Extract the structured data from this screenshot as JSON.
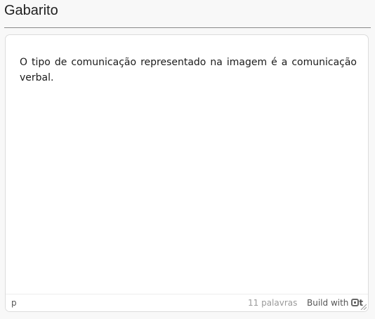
{
  "header": {
    "title": "Gabarito"
  },
  "editor": {
    "content": "O tipo de comunicação representado na imagem é a comunicação verbal.",
    "status": {
      "path": "p",
      "word_count": "11 palavras",
      "brand": "Build with",
      "brand_tail": "t"
    }
  }
}
